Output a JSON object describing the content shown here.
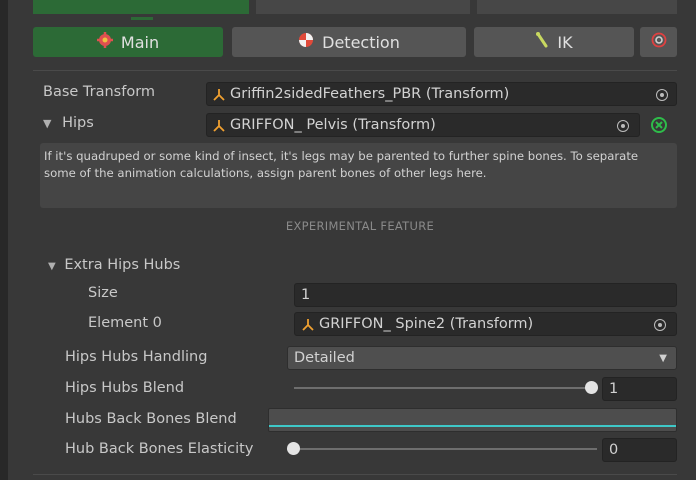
{
  "tabs": [
    {
      "label": "Main"
    },
    {
      "label": "Detection"
    },
    {
      "label": "IK"
    }
  ],
  "base_transform": {
    "label": "Base Transform",
    "value": "Griffin2sidedFeathers_PBR (Transform)"
  },
  "hips": {
    "label": "Hips",
    "value": "GRIFFON_ Pelvis (Transform)"
  },
  "help_text": "If it's quadruped or some kind of insect, it's legs may be parented to further spine bones. To separate some of the animation calculations, assign parent bones of other legs here.",
  "experimental_label": "EXPERIMENTAL FEATURE",
  "extra_hips_hubs": {
    "label": "Extra Hips Hubs",
    "size_label": "Size",
    "size_value": "1",
    "element0_label": "Element 0",
    "element0_value": "GRIFFON_ Spine2 (Transform)"
  },
  "hips_hubs_handling": {
    "label": "Hips Hubs Handling",
    "value": "Detailed"
  },
  "hips_hubs_blend": {
    "label": "Hips Hubs Blend",
    "value": "1",
    "fraction": 1.0
  },
  "hubs_back_bones_blend": {
    "label": "Hubs Back Bones Blend"
  },
  "hub_back_bones_elasticity": {
    "label": "Hub Back Bones Elasticity",
    "value": "0",
    "fraction": 0.0
  },
  "colors": {
    "accent_green": "#2c6a36",
    "cyan_curve": "#3ec8c8",
    "object_icon": "#f0a030"
  },
  "icons": {
    "main": "gear-icon",
    "detection": "target-icon",
    "ik": "bone-icon",
    "settings": "settings-icon"
  }
}
